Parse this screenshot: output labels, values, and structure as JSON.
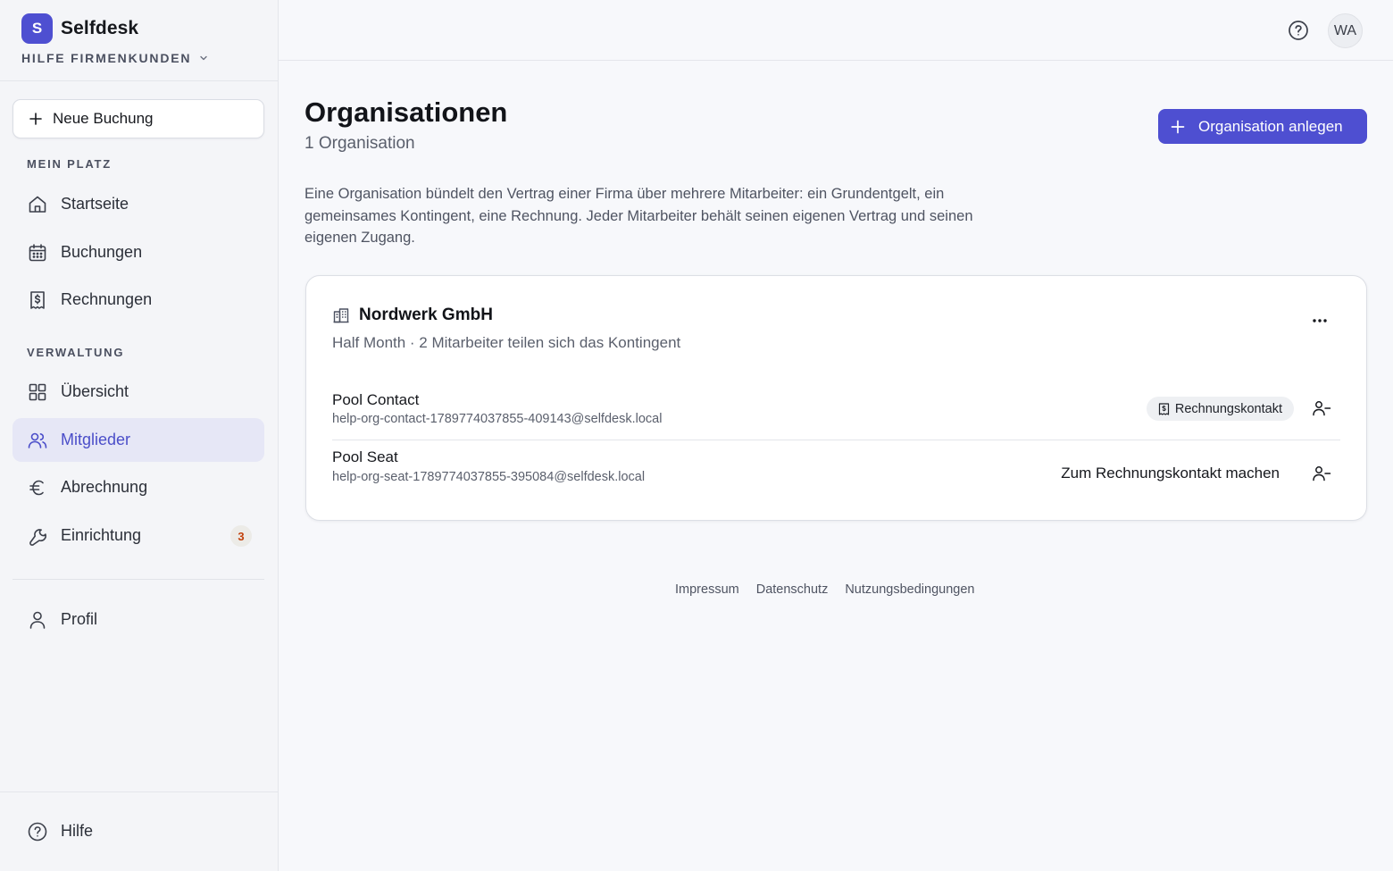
{
  "brand": {
    "logo_letter": "S",
    "name": "Selfdesk",
    "accent": "#4e4fd1"
  },
  "workspace": {
    "label": "HILFE FIRMENKUNDEN",
    "icon": "chevron-down-icon"
  },
  "sidebar": {
    "new_booking_label": "Neue Buchung",
    "sections": [
      {
        "label": "MEIN PLATZ"
      },
      {
        "label": "VERWALTUNG"
      }
    ],
    "items": [
      {
        "label": "Startseite",
        "icon": "home-icon"
      },
      {
        "label": "Buchungen",
        "icon": "calendar-icon"
      },
      {
        "label": "Rechnungen",
        "icon": "invoice-icon"
      },
      {
        "label": "Übersicht",
        "icon": "grid-icon"
      },
      {
        "label": "Mitglieder",
        "icon": "users-icon",
        "active": true
      },
      {
        "label": "Abrechnung",
        "icon": "euro-icon"
      },
      {
        "label": "Einrichtung",
        "icon": "wrench-icon",
        "badge": "3"
      },
      {
        "label": "Profil",
        "icon": "user-icon"
      }
    ],
    "help_label": "Hilfe"
  },
  "topbar": {
    "help_icon": "help-circle-icon",
    "avatar_initials": "WA"
  },
  "main": {
    "title": "Organisationen",
    "subtitle": "1 Organisation",
    "create_button_label": "Organisation anlegen",
    "intro": "Eine Organisation bündelt den Vertrag einer Firma über mehrere Mitarbeiter: ein Grundentgelt, ein gemeinsames Kontingent, eine Rechnung. Jeder Mitarbeiter behält seinen eigenen Vertrag und seinen eigenen Zugang."
  },
  "organization": {
    "name": "Nordwerk GmbH",
    "meta": "Half Month · 2 Mitarbeiter teilen sich das Kontingent",
    "members": [
      {
        "name": "Pool Contact",
        "email": "help-org-contact-1789774037855-409143@selfdesk.local",
        "badge": "Rechnungskontakt"
      },
      {
        "name": "Pool Seat",
        "email": "help-org-seat-1789774037855-395084@selfdesk.local",
        "action_label": "Zum Rechnungskontakt machen"
      }
    ]
  },
  "footer": {
    "links": [
      "Impressum",
      "Datenschutz",
      "Nutzungsbedingungen"
    ]
  }
}
